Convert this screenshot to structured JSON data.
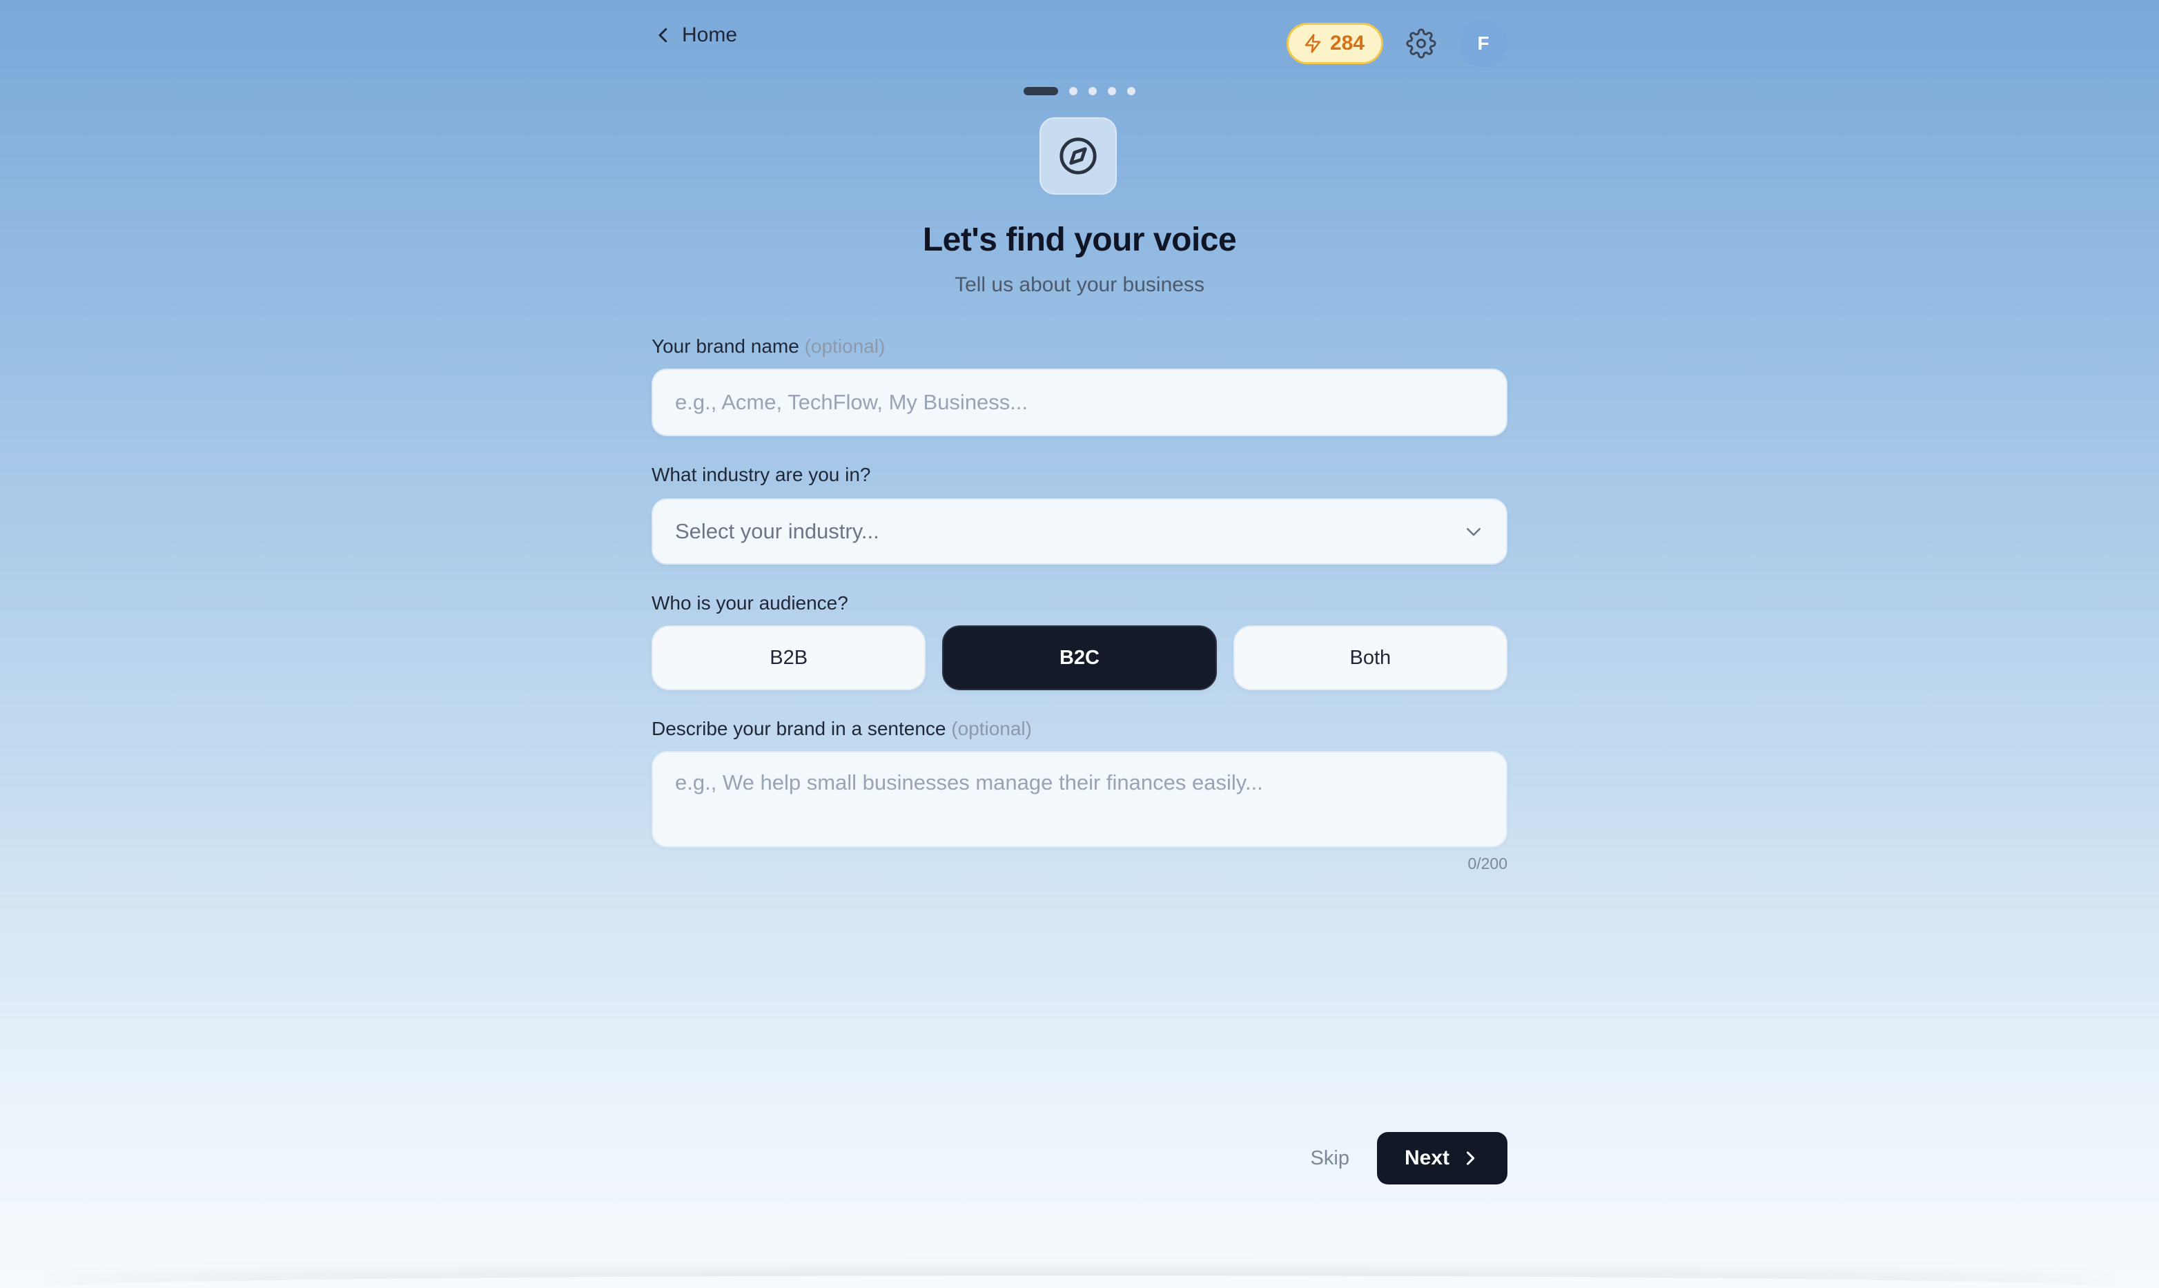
{
  "header": {
    "back_label": "Home",
    "credits": "284",
    "avatar_initial": "F"
  },
  "stepper": {
    "total_steps": 5,
    "current_step": 1
  },
  "hero": {
    "icon": "compass-icon",
    "title": "Let's find your voice",
    "subtitle": "Tell us about your business"
  },
  "form": {
    "brand_name": {
      "label": "Your brand name",
      "optional_tag": "(optional)",
      "value": "",
      "placeholder": "e.g., Acme, TechFlow, My Business..."
    },
    "industry": {
      "label": "What industry are you in?",
      "selected": "Select your industry..."
    },
    "audience": {
      "label": "Who is your audience?",
      "options": [
        "B2B",
        "B2C",
        "Both"
      ],
      "selected": "B2C"
    },
    "description": {
      "label": "Describe your brand in a sentence",
      "optional_tag": "(optional)",
      "value": "",
      "placeholder": "e.g., We help small businesses manage their finances easily...",
      "counter": "0/200"
    }
  },
  "actions": {
    "skip_label": "Skip",
    "next_label": "Next"
  },
  "colors": {
    "primary_dark": "#121826",
    "credits_bg": "#fdf3c8",
    "credits_text": "#d6701a",
    "avatar_bg": "#7aa7dc"
  }
}
